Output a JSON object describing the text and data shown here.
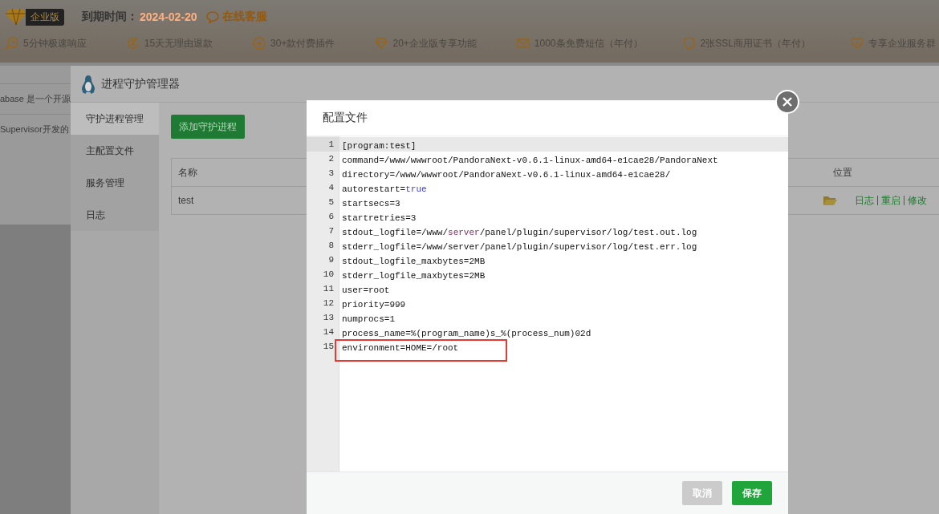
{
  "header": {
    "edition_badge": "企业版",
    "expiry_label": "到期时间：",
    "expiry_date": "2024-02-20",
    "support_link": "在线客服",
    "features": [
      {
        "kind": "clock",
        "text": "5分钟极速响应"
      },
      {
        "kind": "refund",
        "text": "15天无理由退款"
      },
      {
        "kind": "plugin",
        "text": "30+款付费插件"
      },
      {
        "kind": "diamond",
        "text": "20+企业版专享功能"
      },
      {
        "kind": "mail",
        "text": "1000条免费短信（年付）"
      },
      {
        "kind": "shield",
        "text": "2张SSL商用证书（年付）"
      },
      {
        "kind": "heart",
        "text": "专享企业服务群"
      }
    ]
  },
  "background_list": [
    "abase 是一个开源",
    "Supervisor开发的"
  ],
  "process_window": {
    "title": "进程守护管理器",
    "menu": [
      {
        "label": "守护进程管理",
        "selected": true
      },
      {
        "label": "主配置文件",
        "selected": false
      },
      {
        "label": "服务管理",
        "selected": false
      },
      {
        "label": "日志",
        "selected": false
      }
    ],
    "add_button": "添加守护进程",
    "table": {
      "columns": [
        "名称",
        "位置"
      ],
      "rows": [
        {
          "name": "test",
          "actions": [
            "日志",
            "重启",
            "修改"
          ]
        }
      ]
    }
  },
  "dialog": {
    "title": "配置文件",
    "lines": [
      {
        "number": "1",
        "active": true,
        "highlighted": false,
        "segments": [
          {
            "kind": "plain",
            "text": "[program:test]"
          }
        ]
      },
      {
        "number": "2",
        "active": false,
        "highlighted": false,
        "segments": [
          {
            "kind": "plain",
            "text": "command=/www/wwwroot/PandoraNext-v0.6.1-linux-amd64-e1cae28/PandoraNext"
          }
        ]
      },
      {
        "number": "3",
        "active": false,
        "highlighted": false,
        "segments": [
          {
            "kind": "plain",
            "text": "directory=/www/wwwroot/PandoraNext-v0.6.1-linux-amd64-e1cae28/"
          }
        ]
      },
      {
        "number": "4",
        "active": false,
        "highlighted": false,
        "segments": [
          {
            "kind": "plain",
            "text": "autorestart="
          },
          {
            "kind": "atom",
            "text": "true"
          }
        ]
      },
      {
        "number": "5",
        "active": false,
        "highlighted": false,
        "segments": [
          {
            "kind": "plain",
            "text": "startsecs=3"
          }
        ]
      },
      {
        "number": "6",
        "active": false,
        "highlighted": false,
        "segments": [
          {
            "kind": "plain",
            "text": "startretries=3"
          }
        ]
      },
      {
        "number": "7",
        "active": false,
        "highlighted": false,
        "segments": [
          {
            "kind": "plain",
            "text": "stdout_logfile=/www/"
          },
          {
            "kind": "variable",
            "text": "server"
          },
          {
            "kind": "plain",
            "text": "/panel/plugin/supervisor/log/test.out.log"
          }
        ]
      },
      {
        "number": "8",
        "active": false,
        "highlighted": false,
        "segments": [
          {
            "kind": "plain",
            "text": "stderr_logfile=/www/server/panel/plugin/supervisor/log/test.err.log"
          }
        ]
      },
      {
        "number": "9",
        "active": false,
        "highlighted": false,
        "segments": [
          {
            "kind": "plain",
            "text": "stdout_logfile_maxbytes=2MB"
          }
        ]
      },
      {
        "number": "10",
        "active": false,
        "highlighted": false,
        "segments": [
          {
            "kind": "plain",
            "text": "stderr_logfile_maxbytes=2MB"
          }
        ]
      },
      {
        "number": "11",
        "active": false,
        "highlighted": false,
        "segments": [
          {
            "kind": "plain",
            "text": "user=root"
          }
        ]
      },
      {
        "number": "12",
        "active": false,
        "highlighted": false,
        "segments": [
          {
            "kind": "plain",
            "text": "priority=999"
          }
        ]
      },
      {
        "number": "13",
        "active": false,
        "highlighted": false,
        "segments": [
          {
            "kind": "plain",
            "text": "numprocs=1"
          }
        ]
      },
      {
        "number": "14",
        "active": false,
        "highlighted": false,
        "segments": [
          {
            "kind": "plain",
            "text": "process_name=%(program_name)s_%(process_num)02d"
          }
        ]
      },
      {
        "number": "15",
        "active": false,
        "highlighted": true,
        "segments": [
          {
            "kind": "plain",
            "text": "environment=HOME=/root"
          }
        ]
      }
    ],
    "buttons": [
      {
        "kind": "cancel",
        "label": "取消"
      },
      {
        "kind": "primary",
        "label": "保存"
      }
    ]
  }
}
